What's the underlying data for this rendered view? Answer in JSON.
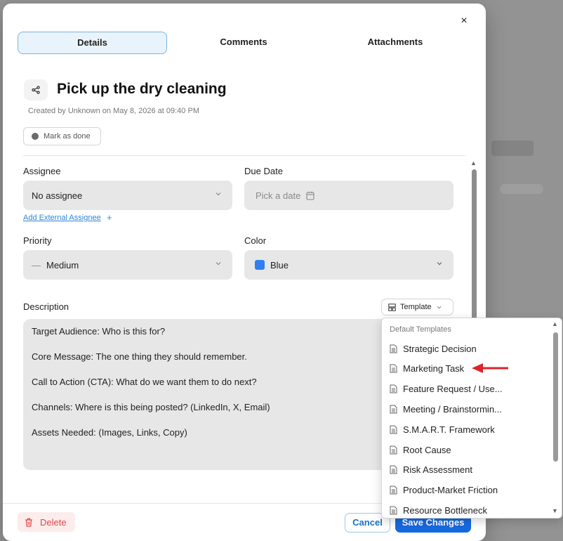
{
  "dialog": {
    "tabs": [
      {
        "label": "Details",
        "active": true
      },
      {
        "label": "Comments",
        "active": false
      },
      {
        "label": "Attachments",
        "active": false
      }
    ],
    "close_symbol": "×",
    "title": "Pick up the dry cleaning",
    "created_text": "Created by Unknown on May 8, 2026 at 09:40 PM",
    "mark_done_label": "Mark as done",
    "assignee": {
      "label": "Assignee",
      "value": "No assignee",
      "add_link": "Add External Assignee",
      "add_plus": "+"
    },
    "due_date": {
      "label": "Due Date",
      "placeholder": "Pick a date"
    },
    "priority": {
      "label": "Priority",
      "value": "Medium",
      "prefix": "—"
    },
    "color": {
      "label": "Color",
      "value": "Blue",
      "swatch": "#2f7ff0"
    },
    "description": {
      "label": "Description",
      "template_label": "Template",
      "lines": [
        "Target Audience: Who is this for?",
        "Core Message: The one thing they should remember.",
        "Call to Action (CTA): What do we want them to do next?",
        "Channels: Where is this being posted? (LinkedIn, X, Email)",
        "Assets Needed: (Images, Links, Copy)"
      ]
    },
    "footer": {
      "delete_label": "Delete",
      "cancel_label": "Cancel",
      "save_label": "Save Changes"
    }
  },
  "template_dropdown": {
    "header": "Default Templates",
    "items": [
      "Strategic Decision",
      "Marketing Task",
      "Feature Request / Use...",
      "Meeting / Brainstormin...",
      "S.M.A.R.T. Framework",
      "Root Cause",
      "Risk Assessment",
      "Product-Market Friction",
      "Resource Bottleneck"
    ]
  },
  "colors": {
    "primary": "#1769e0",
    "danger": "#e24848",
    "annotation_arrow": "#d9262c"
  }
}
